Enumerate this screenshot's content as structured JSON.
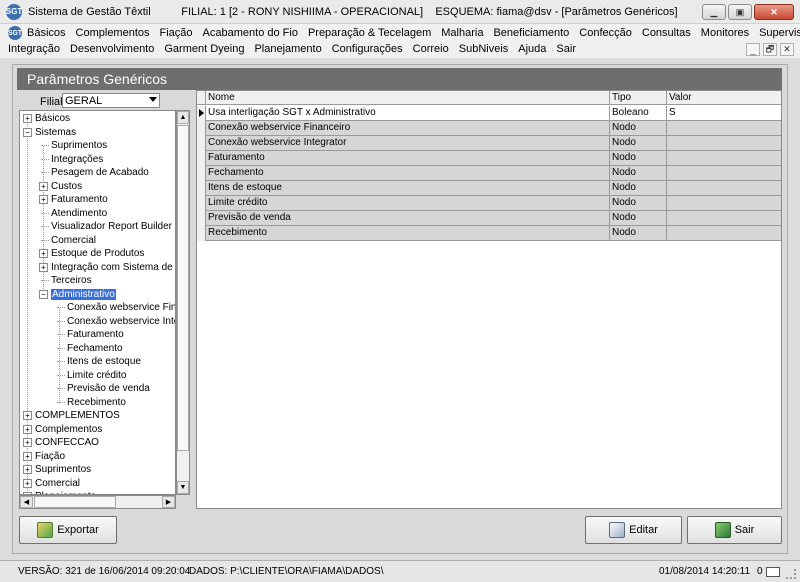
{
  "window": {
    "app_icon_text": "SGT",
    "title": "Sistema de Gestão Têxtil          FILIAL: 1 [2 - RONY NISHIIMA - OPERACIONAL]    ESQUEMA: fiama@dsv - [Parâmetros Genéricos]",
    "minimize": "▁",
    "maximize": "▣",
    "close": "✕"
  },
  "menu": {
    "row1": [
      "Básicos",
      "Complementos",
      "Fiação",
      "Acabamento do Fio",
      "Preparação & Tecelagem",
      "Malharia",
      "Beneficiamento",
      "Confecção",
      "Consultas",
      "Monitores",
      "Supervisão"
    ],
    "row2": [
      "Integração",
      "Desenvolvimento",
      "Garment Dyeing",
      "Planejamento",
      "Configurações",
      "Correio",
      "SubNiveis",
      "Ajuda",
      "Sair"
    ],
    "mdi": [
      "_",
      "🗗",
      "✕"
    ]
  },
  "form": {
    "title": "Parâmetros Genéricos",
    "filial_label": "Filial",
    "filial_value": "GERAL"
  },
  "tree": [
    {
      "label": "Básicos",
      "level": 0,
      "expander": "+"
    },
    {
      "label": "Sistemas",
      "level": 0,
      "expander": "−"
    },
    {
      "label": "Suprimentos",
      "level": 1,
      "expander": ""
    },
    {
      "label": "Integrações",
      "level": 1,
      "expander": ""
    },
    {
      "label": "Pesagem de Acabado",
      "level": 1,
      "expander": ""
    },
    {
      "label": "Custos",
      "level": 1,
      "expander": "+"
    },
    {
      "label": "Faturamento",
      "level": 1,
      "expander": "+"
    },
    {
      "label": "Atendimento",
      "level": 1,
      "expander": ""
    },
    {
      "label": "Visualizador Report Builder",
      "level": 1,
      "expander": ""
    },
    {
      "label": "Comercial",
      "level": 1,
      "expander": ""
    },
    {
      "label": "Estoque de Produtos",
      "level": 1,
      "expander": "+"
    },
    {
      "label": "Integração com Sistema de Bal",
      "level": 1,
      "expander": "+"
    },
    {
      "label": "Terceiros",
      "level": 1,
      "expander": ""
    },
    {
      "label": "Administrativo",
      "level": 1,
      "expander": "−",
      "selected": true
    },
    {
      "label": "Conexão webservice Finan",
      "level": 2,
      "expander": ""
    },
    {
      "label": "Conexão webservice Integr",
      "level": 2,
      "expander": ""
    },
    {
      "label": "Faturamento",
      "level": 2,
      "expander": ""
    },
    {
      "label": "Fechamento",
      "level": 2,
      "expander": ""
    },
    {
      "label": "Itens de estoque",
      "level": 2,
      "expander": ""
    },
    {
      "label": "Limite crédito",
      "level": 2,
      "expander": ""
    },
    {
      "label": "Previsão de venda",
      "level": 2,
      "expander": ""
    },
    {
      "label": "Recebimento",
      "level": 2,
      "expander": ""
    },
    {
      "label": "COMPLEMENTOS",
      "level": 0,
      "expander": "+"
    },
    {
      "label": "Complementos",
      "level": 0,
      "expander": "+"
    },
    {
      "label": "CONFECCAO",
      "level": 0,
      "expander": "+"
    },
    {
      "label": "Fiação",
      "level": 0,
      "expander": "+"
    },
    {
      "label": "Suprimentos",
      "level": 0,
      "expander": "+"
    },
    {
      "label": "Comercial",
      "level": 0,
      "expander": "+"
    },
    {
      "label": "Planejamento",
      "level": 0,
      "expander": "+"
    }
  ],
  "grid": {
    "headers": [
      "Nome",
      "Tipo",
      "Valor"
    ],
    "rows": [
      {
        "nome": "Usa interligação SGT x Administrativo",
        "tipo": "Boleano",
        "valor": "S"
      },
      {
        "nome": "Conexão webservice Financeiro",
        "tipo": "Nodo",
        "valor": ""
      },
      {
        "nome": "Conexão webservice Integrator",
        "tipo": "Nodo",
        "valor": ""
      },
      {
        "nome": "Faturamento",
        "tipo": "Nodo",
        "valor": ""
      },
      {
        "nome": "Fechamento",
        "tipo": "Nodo",
        "valor": ""
      },
      {
        "nome": "Itens de estoque",
        "tipo": "Nodo",
        "valor": ""
      },
      {
        "nome": "Limite crédito",
        "tipo": "Nodo",
        "valor": ""
      },
      {
        "nome": "Previsão de venda",
        "tipo": "Nodo",
        "valor": ""
      },
      {
        "nome": "Recebimento",
        "tipo": "Nodo",
        "valor": ""
      }
    ]
  },
  "buttons": {
    "exportar": "Exportar",
    "editar": "Editar",
    "sair": "Sair"
  },
  "status": {
    "versao": "VERSÃO: 321 de 16/06/2014 09:20:04",
    "dados": "DADOS: P:\\CLIENTE\\ORA\\FIAMA\\DADOS\\",
    "datetime": "01/08/2014 14:20:11",
    "mail_count": "0"
  }
}
